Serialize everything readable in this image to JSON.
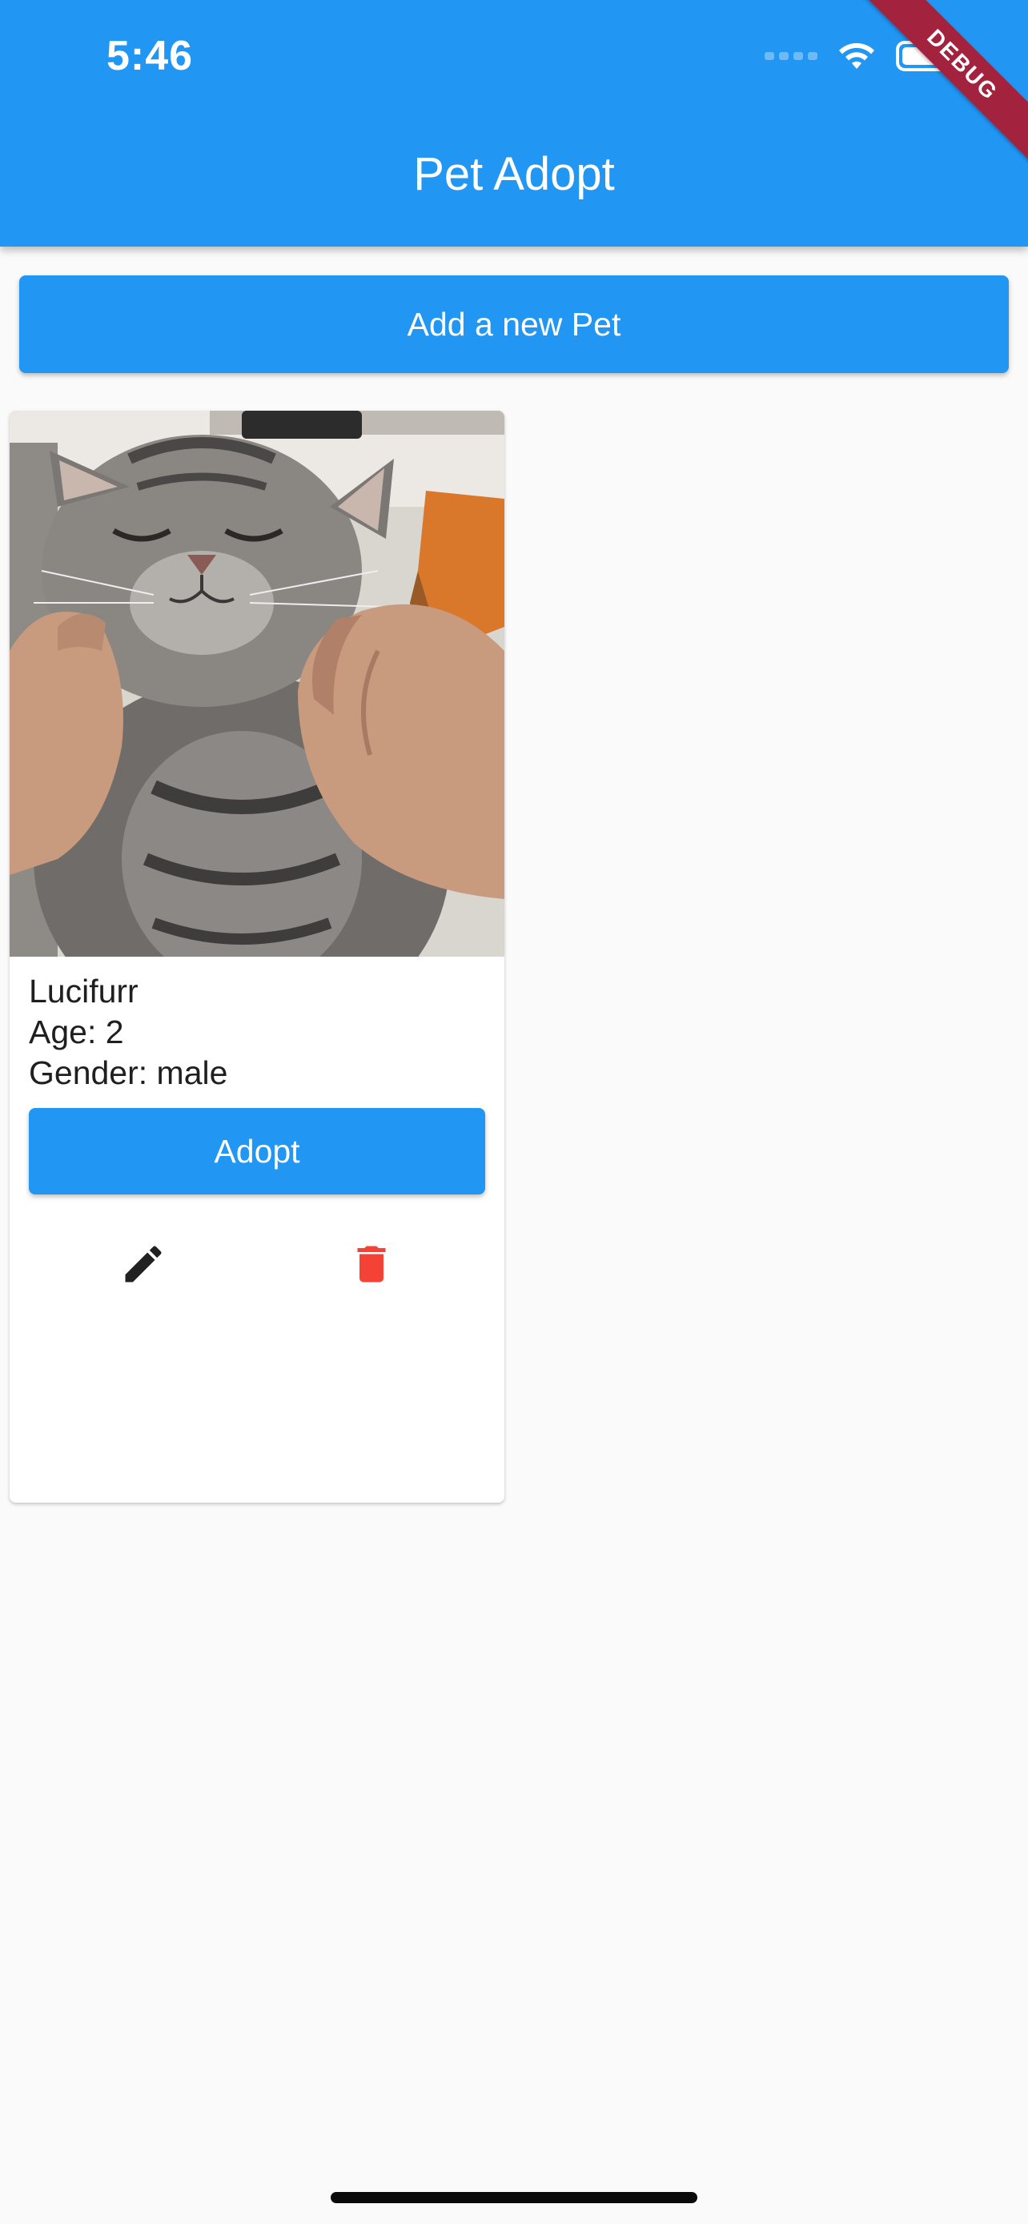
{
  "status_bar": {
    "time": "5:46"
  },
  "app_bar": {
    "title": "Pet Adopt"
  },
  "debug_banner": "DEBUG",
  "add_button_label": "Add a new Pet",
  "pets": [
    {
      "name": "Lucifurr",
      "age": "Age: 2",
      "gender": "Gender: male",
      "adopt_label": "Adopt",
      "edit_icon": "edit-pencil-icon",
      "delete_icon": "delete-trash-icon"
    }
  ],
  "colors": {
    "primary": "#2196f3",
    "background": "#fafafa",
    "delete": "#f44336",
    "debug_banner": "#a3233f"
  }
}
